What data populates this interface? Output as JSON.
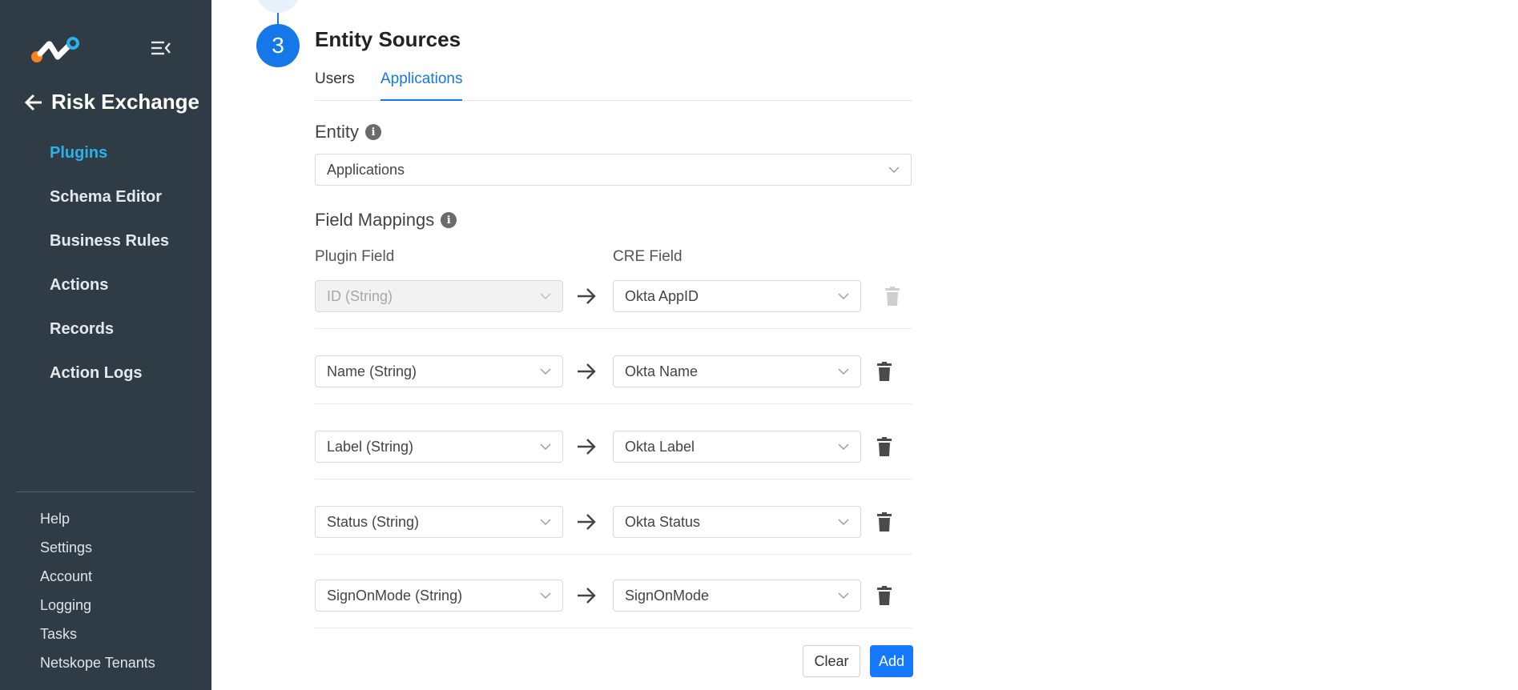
{
  "sidebar": {
    "back_title": "Risk Exchange",
    "nav_items": [
      {
        "label": "Plugins",
        "active": true
      },
      {
        "label": "Schema Editor",
        "active": false
      },
      {
        "label": "Business Rules",
        "active": false
      },
      {
        "label": "Actions",
        "active": false
      },
      {
        "label": "Records",
        "active": false
      },
      {
        "label": "Action Logs",
        "active": false
      }
    ],
    "bottom_items": [
      {
        "label": "Help"
      },
      {
        "label": "Settings"
      },
      {
        "label": "Account"
      },
      {
        "label": "Logging"
      },
      {
        "label": "Tasks"
      },
      {
        "label": "Netskope Tenants"
      }
    ],
    "colors": {
      "background": "#2f3b45",
      "active": "#2ab3e8"
    }
  },
  "step": {
    "number": "3",
    "title": "Entity Sources",
    "tabs": [
      {
        "label": "Users",
        "active": false
      },
      {
        "label": "Applications",
        "active": true
      }
    ]
  },
  "entity": {
    "label": "Entity",
    "value": "Applications"
  },
  "field_mappings": {
    "label": "Field Mappings",
    "plugin_field_header": "Plugin Field",
    "cre_field_header": "CRE Field",
    "rows": [
      {
        "plugin_field": "ID (String)",
        "cre_field": "Okta AppID",
        "locked": true
      },
      {
        "plugin_field": "Name (String)",
        "cre_field": "Okta Name",
        "locked": false
      },
      {
        "plugin_field": "Label (String)",
        "cre_field": "Okta Label",
        "locked": false
      },
      {
        "plugin_field": "Status (String)",
        "cre_field": "Okta Status",
        "locked": false
      },
      {
        "plugin_field": "SignOnMode (String)",
        "cre_field": "SignOnMode",
        "locked": false
      }
    ]
  },
  "actions": {
    "clear_label": "Clear",
    "add_label": "Add"
  },
  "colors": {
    "primary": "#1677e8"
  }
}
